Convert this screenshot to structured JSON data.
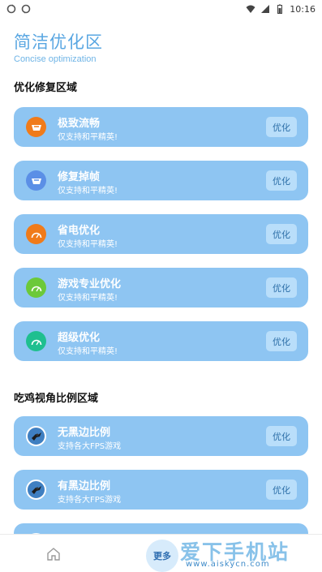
{
  "status_bar": {
    "time": "10:16",
    "left_icons": [
      "sync-icon",
      "sync-icon"
    ],
    "right_icons": [
      "wifi-icon",
      "signal-icon",
      "battery-icon"
    ]
  },
  "header": {
    "title": "简洁优化区",
    "subtitle": "Concise optimization"
  },
  "section_repair": {
    "title": "优化修复区域",
    "items": [
      {
        "name": "极致流畅",
        "desc": "仅支持和平精英!",
        "button": "优化",
        "icon": "speedometer-icon",
        "icon_color": "#f07b1a"
      },
      {
        "name": "修复掉帧",
        "desc": "仅支持和平精英!",
        "button": "优化",
        "icon": "speedometer-icon",
        "icon_color": "#5b8fe6"
      },
      {
        "name": "省电优化",
        "desc": "仅支持和平精英!",
        "button": "优化",
        "icon": "speedometer-icon",
        "icon_color": "#f07b1a"
      },
      {
        "name": "游戏专业优化",
        "desc": "仅支持和平精英!",
        "button": "优化",
        "icon": "speedometer-icon",
        "icon_color": "#6cc93a"
      },
      {
        "name": "超级优化",
        "desc": "仅支持和平精英!",
        "button": "优化",
        "icon": "speedometer-icon",
        "icon_color": "#1fbf8f"
      }
    ]
  },
  "section_ratio": {
    "title": "吃鸡视角比例区域",
    "items": [
      {
        "name": "无黑边比例",
        "desc": "支持各大FPS游戏",
        "button": "优化",
        "icon": "game-avatar-icon"
      },
      {
        "name": "有黑边比例",
        "desc": "支持各大FPS游戏",
        "button": "优化",
        "icon": "game-avatar-icon"
      },
      {
        "name": "",
        "desc": "",
        "button": "",
        "icon": "game-avatar-icon"
      }
    ]
  },
  "bottom_nav": {
    "more_label": "更多",
    "watermark": "爱下手机站",
    "watermark_url": "www.aiskycn.com"
  },
  "colors": {
    "card": "#8ec5f2",
    "button": "#b9defa",
    "title": "#5aa7e2"
  }
}
